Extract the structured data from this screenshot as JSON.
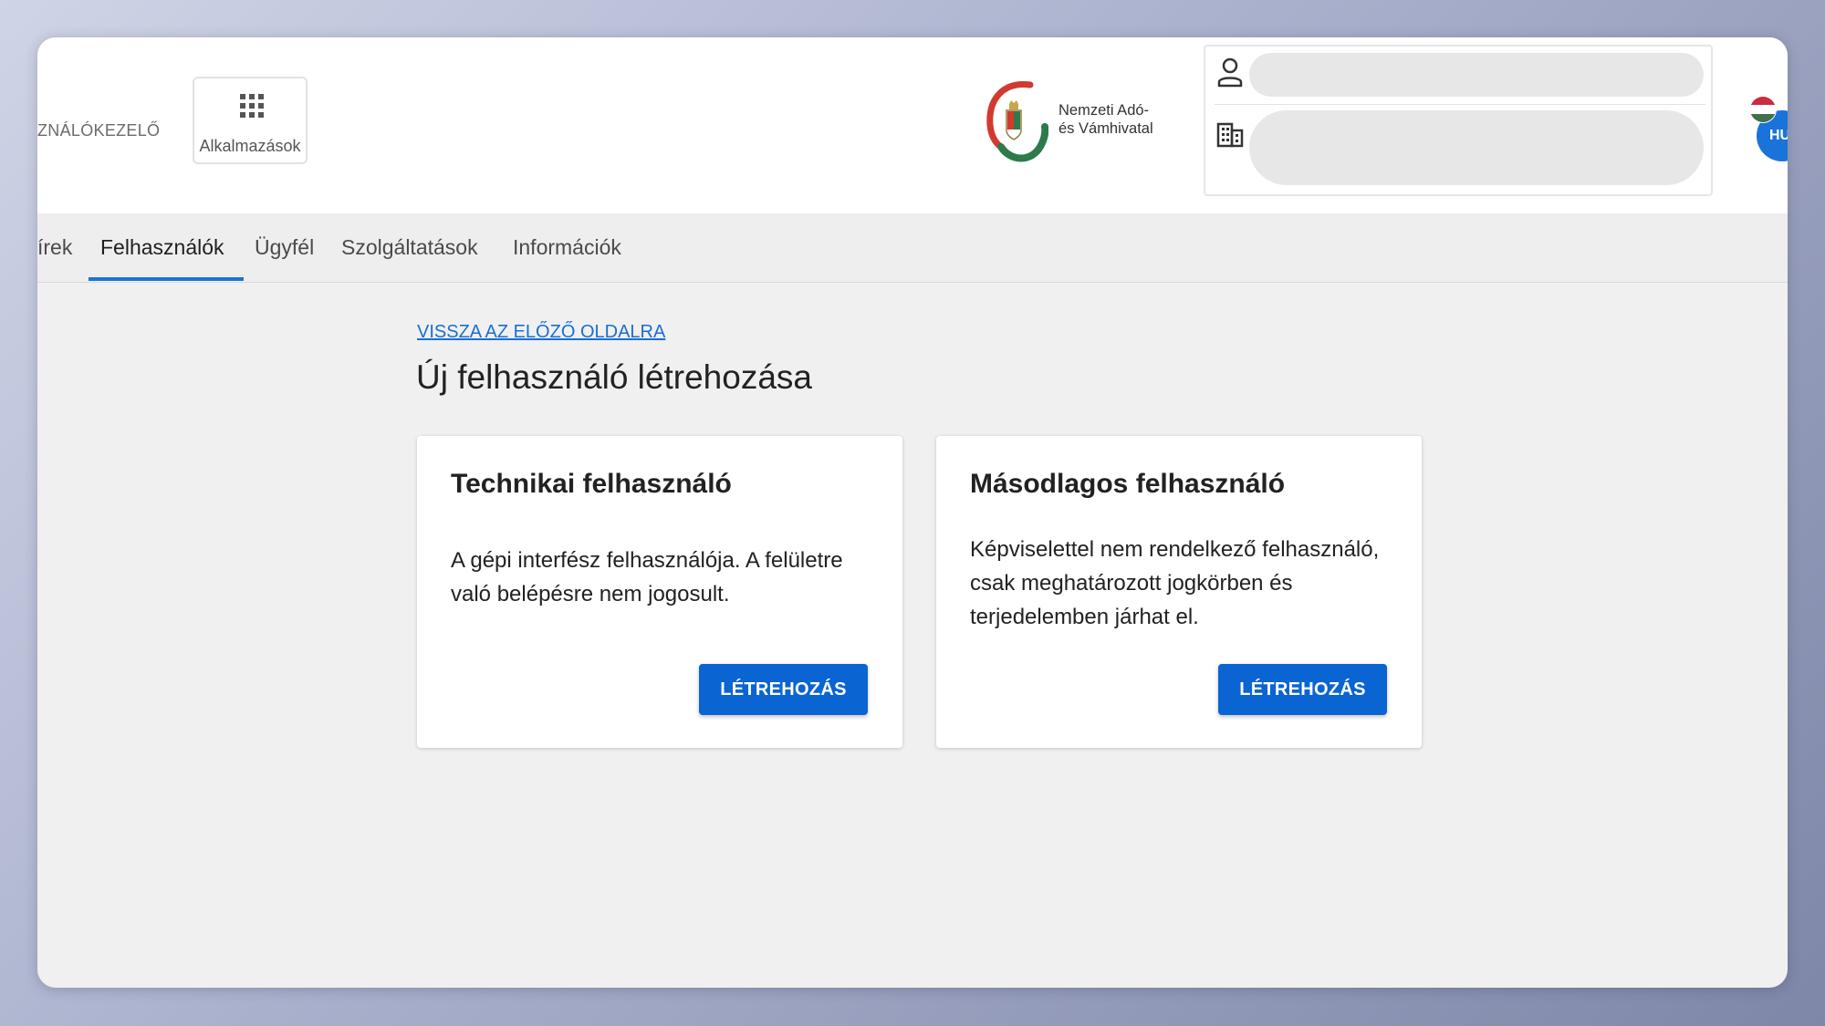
{
  "header": {
    "app_title": "ZNÁLÓKEZELŐ",
    "apps_button_label": "Alkalmazások",
    "logo_text_line1": "Nemzeti Adó-",
    "logo_text_line2": "és Vámhivatal",
    "language_code": "HU",
    "user_field_value": "",
    "organization_field_value": ""
  },
  "tabs": [
    {
      "label": "Hírek",
      "visible_label": "írek",
      "active": false
    },
    {
      "label": "Felhasználók",
      "active": true
    },
    {
      "label": "Ügyfél",
      "active": false
    },
    {
      "label": "Szolgáltatások",
      "active": false
    },
    {
      "label": "Információk",
      "active": false
    }
  ],
  "main": {
    "back_link": "VISSZA AZ ELŐZŐ OLDALRA",
    "page_title": "Új felhasználó létrehozása",
    "cards": [
      {
        "title": "Technikai felhasználó",
        "description": "A gépi interfész felhasználója. A felületre való belépésre nem jogosult.",
        "button_label": "LÉTREHOZÁS"
      },
      {
        "title": "Másodlagos felhasználó",
        "description": "Képviselettel nem rendelkező felhasználó, csak meghatározott jogkörben és terjedelemben járhat el.",
        "button_label": "LÉTREHOZÁS"
      }
    ]
  },
  "colors": {
    "accent": "#1a73d9",
    "button": "#0a64d2",
    "link": "#1a6fd1",
    "flag_red": "#cd2a3e",
    "flag_white": "#ffffff",
    "flag_green": "#436f4d"
  },
  "icons": [
    "apps-grid-icon",
    "nav-logo-icon",
    "person-icon",
    "building-icon",
    "hungarian-flag-icon"
  ]
}
